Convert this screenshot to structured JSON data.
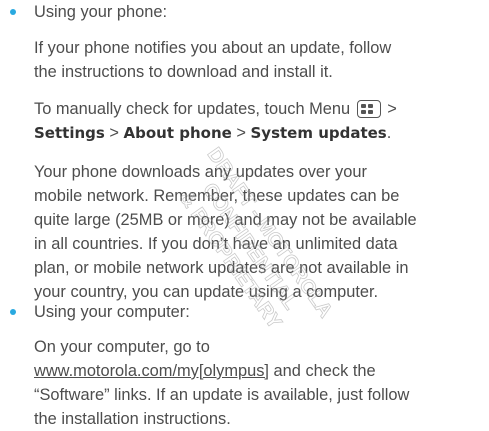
{
  "content": {
    "bullet1": {
      "label": "Using your phone:",
      "para1": [
        "If your phone notifies you about an update, follow",
        "the instructions to download and install it."
      ],
      "para2": {
        "line1_prefix": "To manually check for updates, touch Menu",
        "line1_suffix": ">",
        "line2": {
          "settings": "Settings",
          "sep1": " > ",
          "about": "About phone",
          "sep2": " > ",
          "system": "System updates",
          "end": "."
        }
      },
      "para3": [
        "Your phone downloads any updates over your",
        "mobile network. Remember, these updates can be",
        "quite large (25MB or more) and may not be available",
        "in all countries. If you don’t have an unlimited data",
        "plan, or mobile network updates are not available in",
        "your country, you can update using a computer."
      ]
    },
    "bullet2": {
      "label": "Using your computer:",
      "para1": {
        "line1": "On your computer, go to",
        "link": "www.motorola.com/my[olympus]",
        "line2_rest": " and check the",
        "line3": "“Software” links. If an update is available, just follow",
        "line4": "the installation instructions."
      }
    }
  },
  "watermark": {
    "lines": [
      "DRAFT - MOTOROLA",
      "CONFIDENTIAL",
      "& PROPRIETARY"
    ]
  },
  "colors": {
    "text": "#4d4d4d",
    "bullet": "#29a9e0",
    "watermark": "#a0a0a0"
  },
  "icons": {
    "menu": "menu-key-icon"
  }
}
